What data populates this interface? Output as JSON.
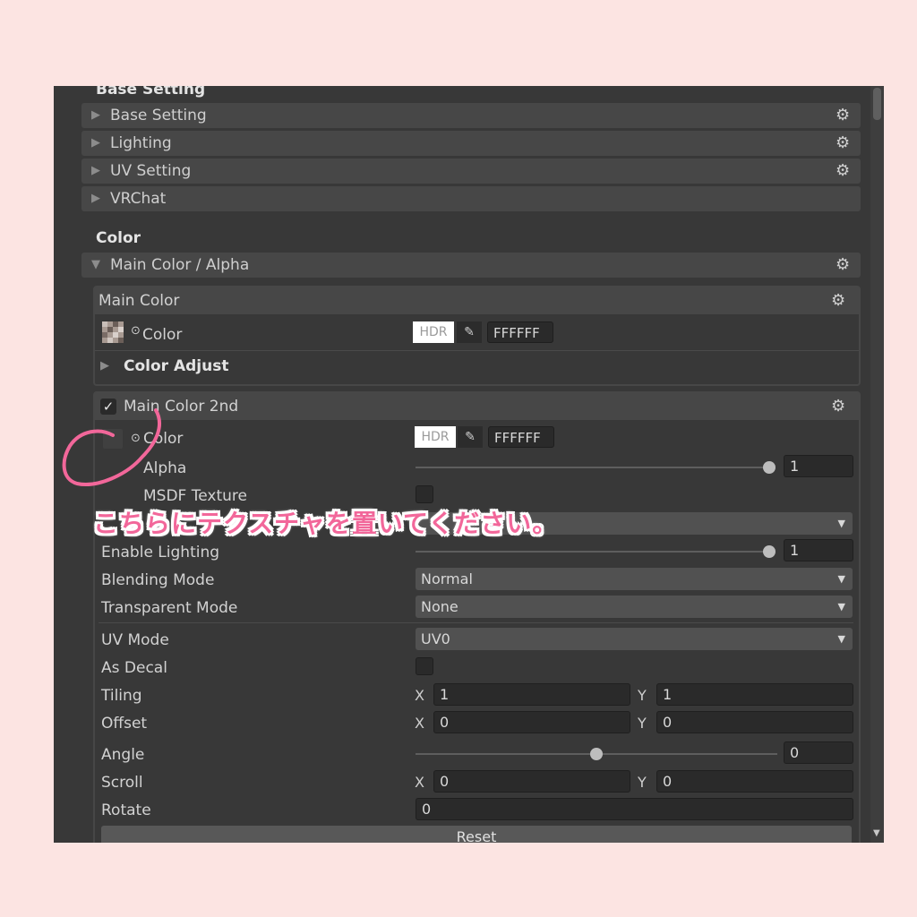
{
  "base_section": {
    "title": "Base Setting",
    "foldouts": [
      {
        "label": "Base Setting"
      },
      {
        "label": "Lighting"
      },
      {
        "label": "UV Setting"
      },
      {
        "label": "VRChat"
      }
    ]
  },
  "color_section": {
    "title": "Color",
    "foldout_label": "Main Color / Alpha",
    "main_color": {
      "title": "Main Color",
      "color_label": "Color",
      "hdr": "HDR",
      "hex": "FFFFFF",
      "adjust_label": "Color Adjust"
    },
    "main_color_2nd": {
      "title": "Main Color 2nd",
      "enabled": true,
      "color_label": "Color",
      "hdr": "HDR",
      "hex": "FFFFFF",
      "alpha_label": "Alpha",
      "alpha_value": "1",
      "alpha_fraction": 1.0,
      "msdf_label": "MSDF Texture",
      "enable_lighting_label": "Enable Lighting",
      "enable_lighting_value": "1",
      "blending_label": "Blending Mode",
      "blending_value": "Normal",
      "transparent_label": "Transparent Mode",
      "transparent_value": "None",
      "uv_mode_label": "UV Mode",
      "uv_mode_value": "UV0",
      "as_decal_label": "As Decal",
      "tiling_label": "Tiling",
      "tiling_x": "1",
      "tiling_y": "1",
      "offset_label": "Offset",
      "offset_x": "0",
      "offset_y": "0",
      "angle_label": "Angle",
      "angle_value": "0",
      "scroll_label": "Scroll",
      "scroll_x": "0",
      "scroll_y": "0",
      "rotate_label": "Rotate",
      "rotate_value": "0",
      "reset_label": "Reset",
      "x_axis": "X",
      "y_axis": "Y"
    }
  },
  "annotation": {
    "text": "こちらにテクスチャを置いてください。",
    "color": "#f2679a"
  },
  "colors": {
    "page_bg": "#fce4e2",
    "panel_bg": "#383838",
    "header_bg": "#474747",
    "field_bg": "#2a2a2a"
  }
}
